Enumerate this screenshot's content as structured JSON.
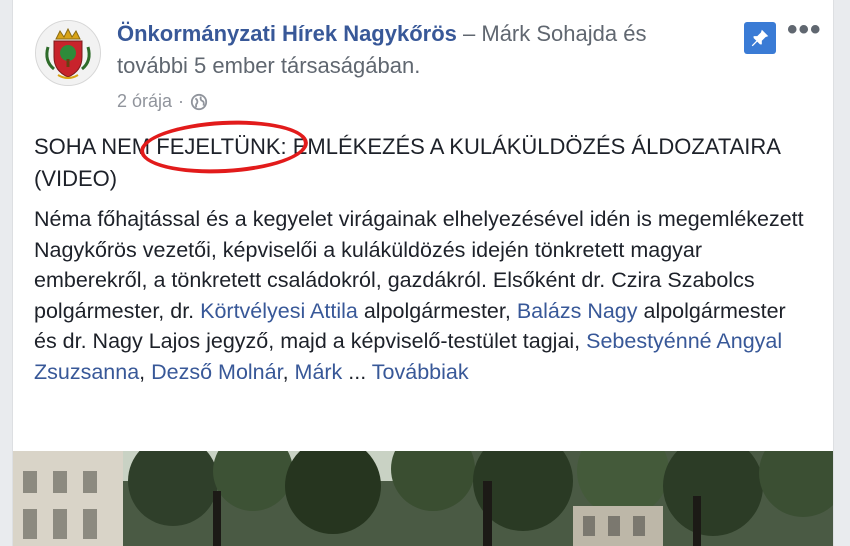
{
  "post": {
    "page_name": "Önkormányzati Hírek Nagykőrös",
    "with_text": " – Márk Sohajda és további 5 ember társaságában.",
    "time": "2 órája",
    "separator": "·",
    "privacy_icon": "globe-icon",
    "pin_icon": "pin-icon",
    "more_icon": "more-options-icon",
    "more_symbol": "•••",
    "title_before": "SOHA NEM ",
    "title_highlight": "FEJELTÜNK:",
    "title_after": " EMLÉKEZÉS A KULÁKÜLDÖZÉS ÁLDOZATAIRA (VIDEO)",
    "body": {
      "p1": "Néma főhajtással és a kegyelet virágainak elhelyezésével idén is megemlékezett Nagykőrös vezetői, képviselői a kuláküldözés idején tönkretett magyar emberekről, a tönkretett családokról, gazdákról. Elsőként dr. Czira Szabolcs polgármester, dr. ",
      "mention1": "Körtvélyesi Attila",
      "p2": " alpolgármester, ",
      "mention2": "Balázs Nagy",
      "p3": " alpolgármester és dr. Nagy Lajos jegyző, majd a képviselő-testület tagjai, ",
      "mention3": "Sebestyénné Angyal Zsuzsanna",
      "p4": ", ",
      "mention4": "Dezső Molnár",
      "p5": ", ",
      "mention5": "Márk",
      "p6": " ... ",
      "more_link": "Továbbiak"
    }
  },
  "colors": {
    "link": "#385898",
    "text": "#1d2129",
    "secondary": "#606770",
    "highlight_circle": "#e21b1b",
    "pin_bg": "#3a7bd5"
  }
}
